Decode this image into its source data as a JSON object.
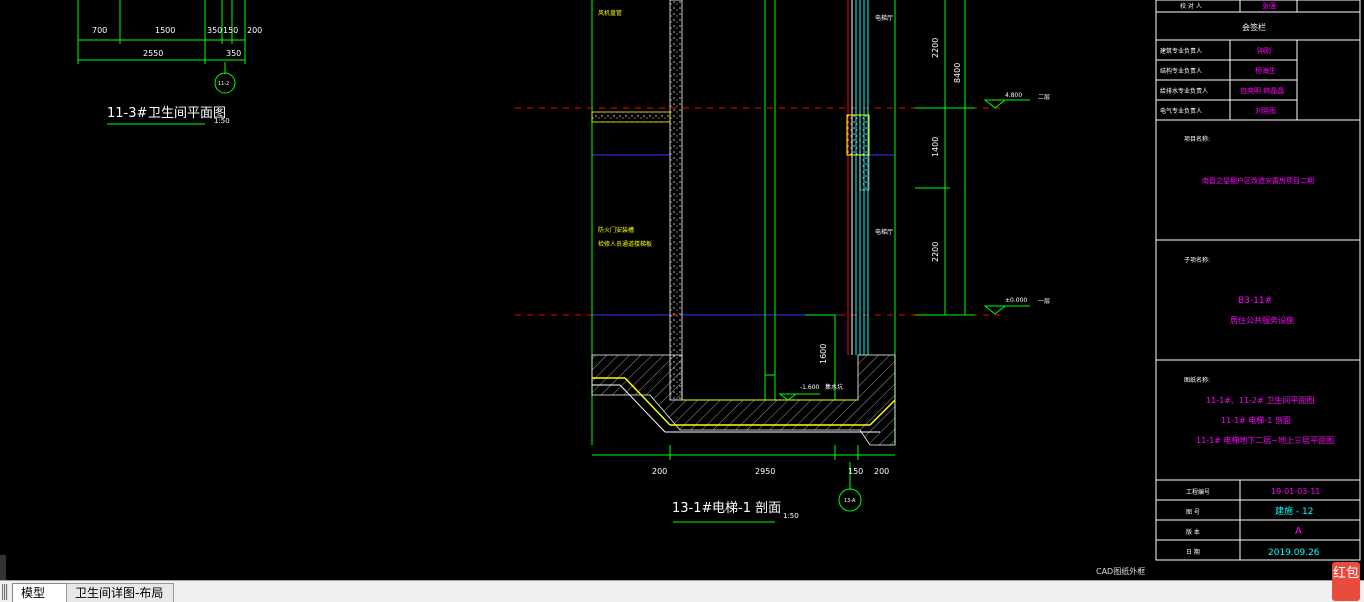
{
  "plan_top": {
    "dims_row1": [
      "700",
      "1500",
      "350",
      "150",
      "200"
    ],
    "dims_row2": [
      "2550",
      "350"
    ],
    "axis_label": "11-2",
    "title_num": "11-3#",
    "title_text": "卫生间平面图",
    "scale": "1:50"
  },
  "section": {
    "notes_left_top": "风机盘管",
    "notes_left_mid1": "防火门安装槽",
    "notes_left_mid2": "检修人员通道楼梯板",
    "label_right_top": "电梯厅",
    "label_right_mid": "电梯厅",
    "elev_top": "4.800",
    "elev_top_floor": "二层",
    "elev_bottom": "±0.000",
    "elev_bottom_floor": "一层",
    "pit_elev": "-1.600",
    "pit_label": "集水坑",
    "dim_v1": "2200",
    "dim_v2": "1400",
    "dim_v3": "2200",
    "dim_total": "8400",
    "dim_pit": "1600",
    "dims_bottom": [
      "200",
      "2950",
      "150",
      "200"
    ],
    "axis_label": "13-A",
    "title_num": "13-1#",
    "title_text": "电梯-1 剖面",
    "scale": "1:50"
  },
  "title_block": {
    "row_check_label": "校 对 人",
    "row_check_value": "张强",
    "signature_title": "会签栏",
    "sign_rows": [
      {
        "label": "建筑专业负责人",
        "value": "钟刚"
      },
      {
        "label": "结构专业负责人",
        "value": "杨海生"
      },
      {
        "label": "给排水专业负责人",
        "value": "包奕明 韩晶晶"
      },
      {
        "label": "电气专业负责人",
        "value": "刘晓雨"
      }
    ],
    "project_label": "项目名称:",
    "project_value": "南昌之星棚户区改造安置房项目二期",
    "sub_label": "子项名称:",
    "sub_value1": "B3-11#",
    "sub_value2": "居住公共服务设施",
    "drawing_label": "图纸名称:",
    "drawing_lines": [
      "11-1#、11-2# 卫生间平面图",
      "11-1# 电梯-1 剖面",
      "11-1# 电梯地下二层~地上三层平面图"
    ],
    "info_rows": [
      {
        "label": "工程编号",
        "value": "19-01-03-11"
      },
      {
        "label": "图  号",
        "value": "建施 -  12"
      },
      {
        "label": "版  本",
        "value": "A"
      },
      {
        "label": "日  期",
        "value": "2019.09.26"
      }
    ]
  },
  "status_bar": {
    "tab_model": "模型",
    "tab_layout": "卫生间详图-布局",
    "bottom_note": "CAD图纸外框",
    "hongbao": "红包"
  },
  "colors": {
    "background": "#000000",
    "magenta": "#ff00ff",
    "green": "#00ff00",
    "yellow": "#ffff00",
    "white": "#ffffff",
    "red_dash": "#ff0000",
    "blue": "#0000ff",
    "cyan": "#00ffff"
  }
}
